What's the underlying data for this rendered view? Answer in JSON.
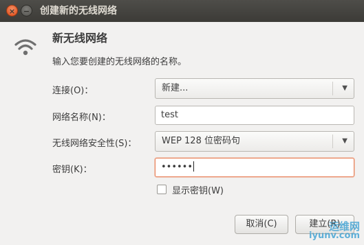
{
  "window": {
    "title": "创建新的无线网络",
    "close_glyph": "×",
    "minimize_glyph": "−"
  },
  "dialog": {
    "icon": "wifi-icon",
    "heading": "新无线网络",
    "description": "输入您要创建的无线网络的名称。",
    "connection": {
      "label": "连接(O)：",
      "value": "新建..."
    },
    "network_name": {
      "label": "网络名称(N)：",
      "value": "test"
    },
    "security": {
      "label": "无线网络安全性(S)：",
      "value": "WEP 128 位密码句"
    },
    "key": {
      "label": "密钥(K)：",
      "value": "••••••"
    },
    "show_key": {
      "label": "显示密钥(W)",
      "checked": false
    },
    "buttons": {
      "cancel": "取消(C)",
      "create": "建立(R)"
    },
    "dropdown_arrow": "▼"
  },
  "watermark": {
    "top": "运维网",
    "bottom": "iyunv.com"
  },
  "colors": {
    "titlebar": "#3c3b37",
    "close_button": "#df4a16",
    "focus_border": "#e9835c",
    "background": "#f2f1f0"
  }
}
